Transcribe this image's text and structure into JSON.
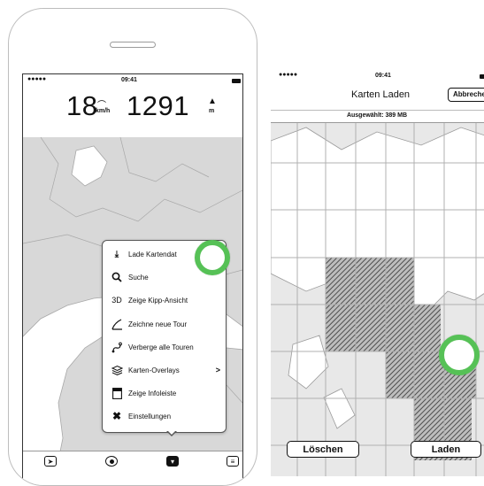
{
  "left_phone": {
    "status_time": "09:41",
    "speed_value": "18",
    "speed_unit": "km/h",
    "altitude_value": "1291",
    "altitude_unit": "m",
    "menu_items": [
      {
        "icon": "download-icon",
        "label": "Lade Kartendat"
      },
      {
        "icon": "search-icon",
        "label": "Suche"
      },
      {
        "icon": "3d-icon",
        "glyph": "3D",
        "label": "Zeige Kipp-Ansicht"
      },
      {
        "icon": "draw-line-icon",
        "label": "Zeichne neue Tour"
      },
      {
        "icon": "route-icon",
        "label": "Verberge alle Touren"
      },
      {
        "icon": "layers-icon",
        "label": "Karten-Overlays",
        "chevron": ">"
      },
      {
        "icon": "info-bar-icon",
        "label": "Zeige Infoleiste"
      },
      {
        "icon": "wrench-icon",
        "label": "Einstellungen"
      }
    ],
    "tabbar": [
      "location-arrow-icon",
      "record-icon",
      "chat-bubble-icon",
      "list-icon"
    ]
  },
  "right_phone": {
    "status_time": "09:41",
    "title": "Karten Laden",
    "cancel_label": "Abbrechen",
    "selected_label": "Ausgewählt: 389 MB",
    "delete_label": "Löschen",
    "load_label": "Laden"
  },
  "colors": {
    "map_background": "#d8d8d8",
    "land": "#ffffff",
    "touch_indicator": "#56c156",
    "selected_hatch": "#555555"
  }
}
